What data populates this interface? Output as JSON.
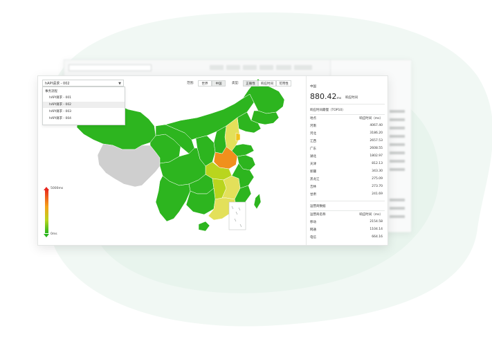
{
  "dropdown": {
    "selected": "hAPI请求 - 002",
    "group_label": "事务流程",
    "items": [
      "hAPI请求 - 001",
      "hAPI请求 - 002",
      "hAPI请求 - 003",
      "hAPI请求 - 004"
    ],
    "selected_index": 1
  },
  "toolbar": {
    "range_label": "范围:",
    "range_options": [
      "世界",
      "中国"
    ],
    "range_active": "中国",
    "type_label": "类型:",
    "type_options": [
      "正确性",
      "响应时间",
      "可用性"
    ],
    "type_active": "正确性"
  },
  "legend": {
    "max": "5000ms",
    "min": "0ms"
  },
  "side": {
    "region": "中国",
    "value": "880.42",
    "unit": "ms",
    "value_caption": "响应时间",
    "top10_title": "响应时间最慢（TOP10）",
    "col_region": "地点",
    "col_time": "响应时间（ms）",
    "top10": [
      {
        "name": "河南",
        "value": "4067.40"
      },
      {
        "name": "河北",
        "value": "3186.20"
      },
      {
        "name": "江西",
        "value": "2657.53"
      },
      {
        "name": "广东",
        "value": "2608.55"
      },
      {
        "name": "湖北",
        "value": "1802.97"
      },
      {
        "name": "天津",
        "value": "812.13"
      },
      {
        "name": "新疆",
        "value": "343.30"
      },
      {
        "name": "黑龙江",
        "value": "275.09"
      },
      {
        "name": "吉林",
        "value": "273.70"
      },
      {
        "name": "甘肃",
        "value": "241.69"
      }
    ],
    "isp_title": "运营商数据",
    "col_isp": "运营商名称",
    "isp": [
      {
        "name": "移动",
        "value": "2154.58"
      },
      {
        "name": "网通",
        "value": "1104.14"
      },
      {
        "name": "电信",
        "value": "664.16"
      }
    ]
  },
  "colors": {
    "green": "#2db51f",
    "grey": "#cfcfcf",
    "orange": "#f0901c",
    "yellow": "#e3e05a"
  }
}
